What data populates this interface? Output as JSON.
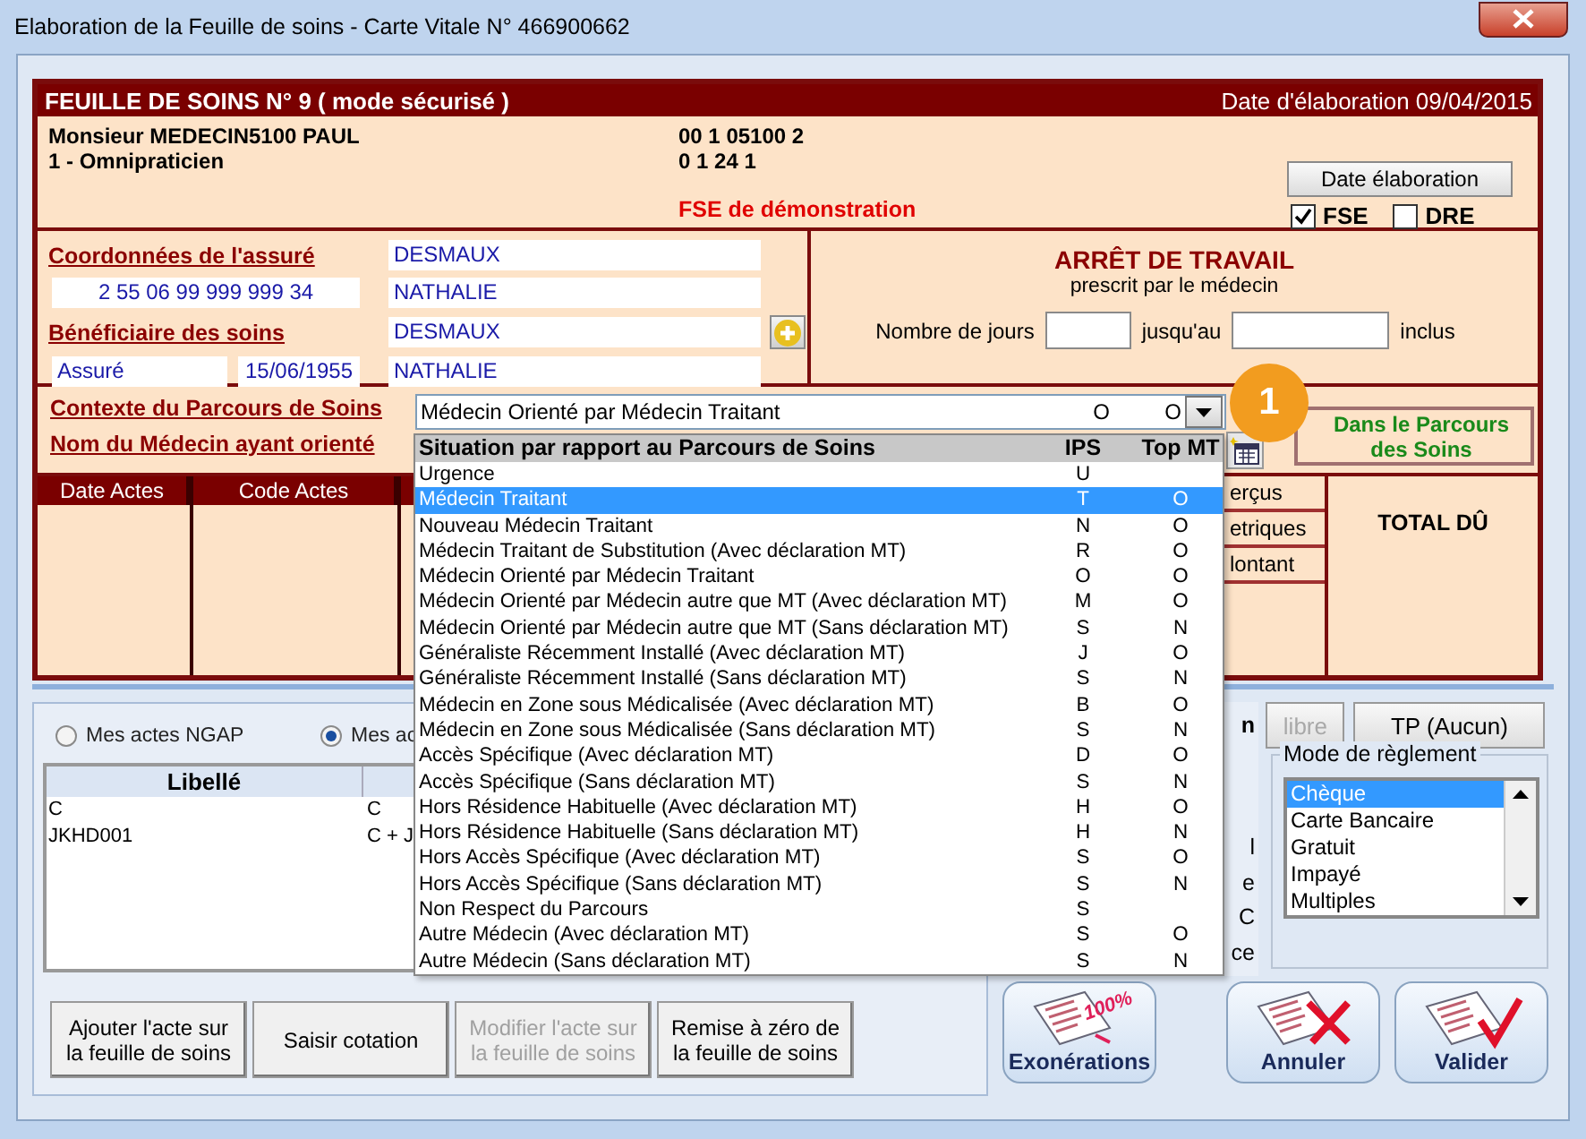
{
  "window": {
    "title": "Elaboration de la Feuille de soins - Carte Vitale N° 466900662"
  },
  "sheet": {
    "title": "FEUILLE DE SOINS  N° 9 ( mode sécurisé )",
    "date": "Date d'élaboration 09/04/2015"
  },
  "doctor": {
    "name": "Monsieur MEDECIN5100 PAUL",
    "specialty": "1 - Omnipraticien",
    "number_1": "00 1 05100 2",
    "number_2": "0 1 24 1",
    "notice": "FSE de démonstration",
    "date_button": "Date élaboration",
    "options": [
      {
        "label": "FSE",
        "checked": true
      },
      {
        "label": "DRE",
        "checked": false
      }
    ]
  },
  "insured": {
    "coordinates_label": "Coordonnées de l'assuré",
    "nir": "2 55 06 99 999 999 34",
    "last_name": "DESMAUX",
    "first_name": "NATHALIE",
    "beneficiary_label": "Bénéficiaire des soins",
    "beneficiary_last_name": "DESMAUX",
    "beneficiary_first_name": "NATHALIE",
    "quality": "Assuré",
    "birth_date": "15/06/1955"
  },
  "work_stoppage": {
    "title": "ARRÊT DE TRAVAIL",
    "subtitle": "prescrit par le médecin",
    "days_label": "Nombre de jours",
    "until_label": "jusqu'au",
    "inclusive_label": "inclus"
  },
  "pathway": {
    "context_label": "Contexte du Parcours de Soins",
    "doctor_label": "Nom du Médecin ayant orienté",
    "combo": {
      "value": "Médecin Orienté par Médecin Traitant",
      "ips": "O",
      "top_mt": "O"
    },
    "status": "Dans le Parcours des Soins"
  },
  "acts_table": {
    "columns": [
      "Date Actes",
      "Code Actes"
    ],
    "fragments": [
      "erçus",
      "etriques",
      "lontant"
    ],
    "total_label": "TOTAL DÛ"
  },
  "dropdown": {
    "columns": [
      "Situation par rapport au Parcours de Soins",
      "IPS",
      "Top MT"
    ],
    "rows": [
      {
        "label": "Urgence",
        "ips": "U",
        "top_mt": "",
        "selected": false
      },
      {
        "label": "Médecin Traitant",
        "ips": "T",
        "top_mt": "O",
        "selected": true
      },
      {
        "label": "Nouveau Médecin Traitant",
        "ips": "N",
        "top_mt": "O",
        "selected": false
      },
      {
        "label": "Médecin Traitant de Substitution (Avec déclaration MT)",
        "ips": "R",
        "top_mt": "O",
        "selected": false
      },
      {
        "label": "Médecin Orienté par Médecin Traitant",
        "ips": "O",
        "top_mt": "O",
        "selected": false
      },
      {
        "label": "Médecin Orienté par Médecin autre que MT (Avec déclaration MT)",
        "ips": "M",
        "top_mt": "O",
        "selected": false
      },
      {
        "label": "Médecin Orienté par Médecin autre que MT (Sans déclaration MT)",
        "ips": "S",
        "top_mt": "N",
        "selected": false
      },
      {
        "label": "Généraliste Récemment Installé (Avec déclaration MT)",
        "ips": "J",
        "top_mt": "O",
        "selected": false
      },
      {
        "label": "Généraliste Récemment Installé (Sans déclaration MT)",
        "ips": "S",
        "top_mt": "N",
        "selected": false
      },
      {
        "label": "Médecin en Zone sous Médicalisée (Avec déclaration MT)",
        "ips": "B",
        "top_mt": "O",
        "selected": false
      },
      {
        "label": "Médecin en Zone sous Médicalisée (Sans déclaration MT)",
        "ips": "S",
        "top_mt": "N",
        "selected": false
      },
      {
        "label": "Accès Spécifique (Avec déclaration MT)",
        "ips": "D",
        "top_mt": "O",
        "selected": false
      },
      {
        "label": "Accès Spécifique (Sans déclaration MT)",
        "ips": "S",
        "top_mt": "N",
        "selected": false
      },
      {
        "label": "Hors Résidence Habituelle (Avec déclaration MT)",
        "ips": "H",
        "top_mt": "O",
        "selected": false
      },
      {
        "label": "Hors Résidence Habituelle (Sans déclaration MT)",
        "ips": "H",
        "top_mt": "N",
        "selected": false
      },
      {
        "label": "Hors Accès Spécifique (Avec déclaration MT)",
        "ips": "S",
        "top_mt": "O",
        "selected": false
      },
      {
        "label": "Hors Accès Spécifique (Sans déclaration MT)",
        "ips": "S",
        "top_mt": "N",
        "selected": false
      },
      {
        "label": "Non Respect du Parcours",
        "ips": "S",
        "top_mt": "",
        "selected": false
      },
      {
        "label": "Autre Médecin (Avec déclaration MT)",
        "ips": "S",
        "top_mt": "O",
        "selected": false
      },
      {
        "label": "Autre Médecin (Sans déclaration MT)",
        "ips": "S",
        "top_mt": "N",
        "selected": false
      }
    ]
  },
  "step_badge": "1",
  "act_picker": {
    "sources": [
      {
        "label": "Mes actes NGAP",
        "selected": false
      },
      {
        "label": "Mes ac",
        "selected": true
      }
    ],
    "columns": [
      "Libellé"
    ],
    "rows": [
      [
        "C",
        "C"
      ],
      [
        "JKHD001",
        "C + J"
      ]
    ]
  },
  "actions": [
    {
      "label": "Ajouter l'acte sur la feuille de soins",
      "disabled": false
    },
    {
      "label": "Saisir cotation",
      "disabled": false
    },
    {
      "label": "Modifier l'acte sur la feuille de soins",
      "disabled": true
    },
    {
      "label": "Remise à zéro de la feuille de soins",
      "disabled": false
    }
  ],
  "side_fragments": {
    "heading": "n",
    "lines": [
      "l",
      "e",
      "C",
      "ce"
    ]
  },
  "payment": {
    "free_button": {
      "label": "libre",
      "disabled": true
    },
    "tp_button": "TP (Aucun)",
    "group_label": "Mode de règlement",
    "methods": [
      {
        "label": "Chèque",
        "selected": true
      },
      {
        "label": "Carte Bancaire",
        "selected": false
      },
      {
        "label": "Gratuit",
        "selected": false
      },
      {
        "label": "Impayé",
        "selected": false
      },
      {
        "label": "Multiples",
        "selected": false
      }
    ]
  },
  "big_buttons": [
    {
      "label": "Exonérations",
      "kind": "exemption",
      "stamp": "100%"
    },
    {
      "label": "Annuler",
      "kind": "cancel"
    },
    {
      "label": "Valider",
      "kind": "validate"
    }
  ]
}
